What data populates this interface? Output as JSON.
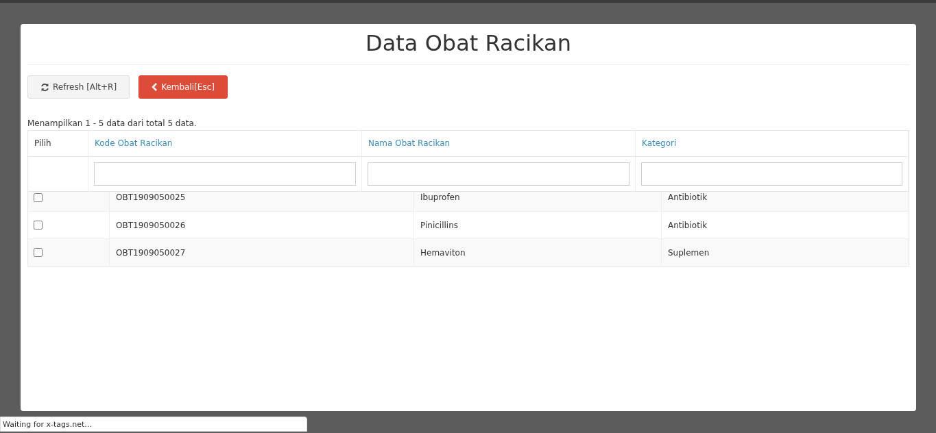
{
  "modal": {
    "title": "Data Obat Racikan",
    "buttons": [
      {
        "kind": "refresh",
        "label": "Refresh [Alt+R]"
      },
      {
        "kind": "back",
        "label": "Kembali[Esc]"
      }
    ],
    "summary": "Menampilkan 1 - 5 data dari total 5 data.",
    "header_table": {
      "columns": [
        {
          "label": "Pilih",
          "sortable": false
        },
        {
          "label": "Kode Obat Racikan",
          "sortable": true
        },
        {
          "label": "Nama Obat Racikan",
          "sortable": true
        },
        {
          "label": "Kategori",
          "sortable": true
        }
      ]
    },
    "results_table": {
      "rows": [
        {
          "checked": false,
          "cells": [
            "OBT1909050025",
            "Ibuprofen",
            "Antibiotik"
          ]
        },
        {
          "checked": false,
          "cells": [
            "OBT1909050026",
            "Pinicillins",
            "Antibiotik"
          ]
        },
        {
          "checked": false,
          "cells": [
            "OBT1909050027",
            "Hemaviton",
            "Suplemen"
          ]
        }
      ]
    }
  },
  "status_bar": {
    "text": "Waiting for x-tags.net..."
  }
}
